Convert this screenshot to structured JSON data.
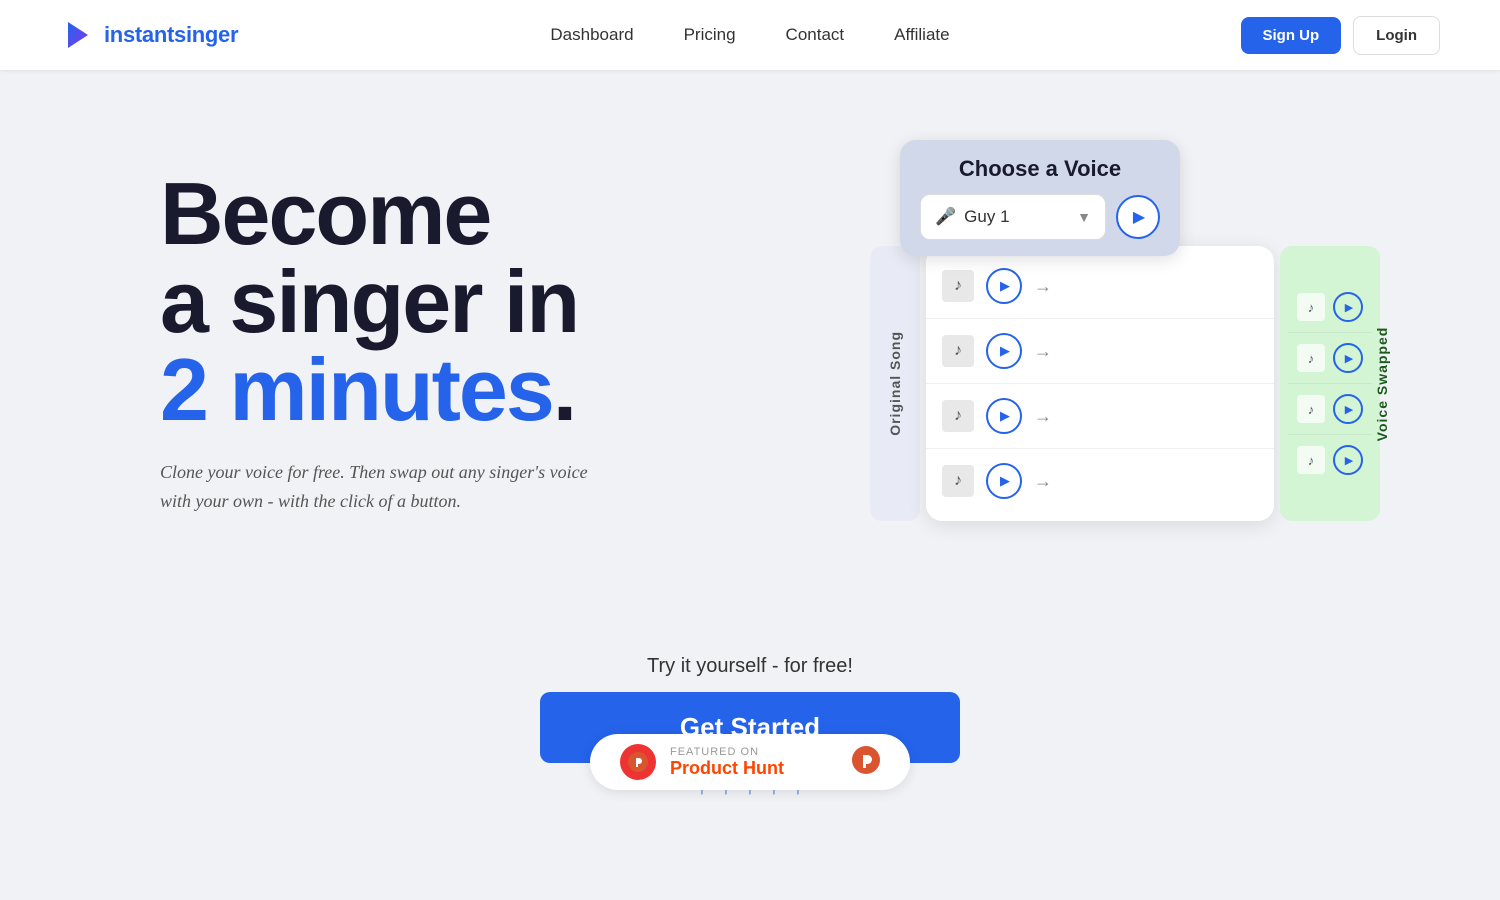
{
  "nav": {
    "logo_text_normal": "instant",
    "logo_text_blue": "singer",
    "links": [
      {
        "label": "Dashboard",
        "key": "dashboard"
      },
      {
        "label": "Pricing",
        "key": "pricing"
      },
      {
        "label": "Contact",
        "key": "contact"
      },
      {
        "label": "Affiliate",
        "key": "affiliate"
      }
    ],
    "signup_label": "Sign Up",
    "login_label": "Login"
  },
  "hero": {
    "title_line1": "Become",
    "title_line2": "a singer in",
    "title_line3": "2 minutes",
    "title_period": ".",
    "subtitle": "Clone your voice for free. Then swap out any singer's voice with your own - with the click of a button.",
    "cta_label": "Try it yourself - for free!",
    "cta_button": "Get Started"
  },
  "voice_ui": {
    "choose_voice_title": "Choose a Voice",
    "selected_voice": "🎤 Guy 1",
    "voice_emoji": "🎤",
    "voice_name": "Guy 1",
    "original_song_label": "Original Song",
    "voice_swapped_label": "Voice Swapped",
    "songs": [
      {
        "thumb": "🎵"
      },
      {
        "thumb": "🎵"
      },
      {
        "thumb": "🎵"
      },
      {
        "thumb": "🎵"
      }
    ]
  },
  "featured": {
    "prefix": "FEATURED ON",
    "name": "Product Hunt"
  }
}
